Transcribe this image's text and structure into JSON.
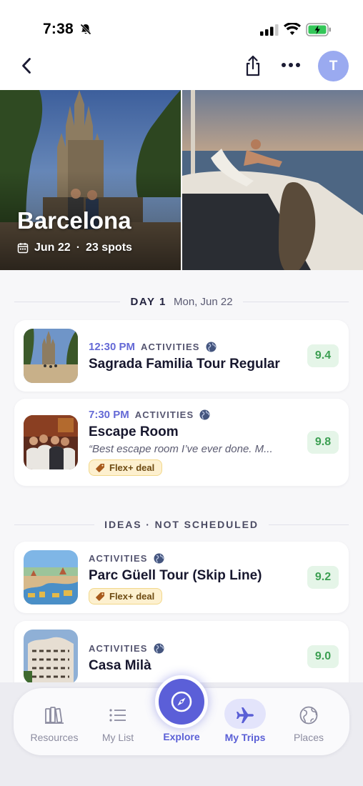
{
  "status_bar": {
    "time": "7:38"
  },
  "nav": {
    "avatar_initial": "T"
  },
  "hero": {
    "title": "Barcelona",
    "date": "Jun 22",
    "separator": "·",
    "spots": "23 spots"
  },
  "day1": {
    "label": "DAY 1",
    "date": "Mon, Jun 22"
  },
  "scheduled": [
    {
      "time": "12:30 PM",
      "category": "ACTIVITIES",
      "title": "Sagrada Familia Tour Regular",
      "score": "9.4"
    },
    {
      "time": "7:30 PM",
      "category": "ACTIVITIES",
      "title": "Escape Room",
      "quote": "“Best escape room I’ve ever done. M...",
      "deal": "Flex+ deal",
      "score": "9.8"
    }
  ],
  "ideas": {
    "label": "IDEAS · NOT SCHEDULED",
    "items": [
      {
        "category": "ACTIVITIES",
        "title": "Parc Güell Tour (Skip Line)",
        "deal": "Flex+ deal",
        "score": "9.2"
      },
      {
        "category": "ACTIVITIES",
        "title": "Casa Milà",
        "score": "9.0"
      }
    ]
  },
  "tabs": [
    {
      "label": "Resources",
      "icon": "books-icon"
    },
    {
      "label": "My List",
      "icon": "list-icon"
    },
    {
      "label": "Explore",
      "icon": "compass-icon"
    },
    {
      "label": "My Trips",
      "icon": "airplane-icon"
    },
    {
      "label": "Places",
      "icon": "globe-icon"
    }
  ],
  "colors": {
    "accent": "#5b5fd8",
    "score_bg": "#e5f5e8",
    "score_text": "#3c9f52",
    "deal_bg": "#fdf0cf"
  }
}
